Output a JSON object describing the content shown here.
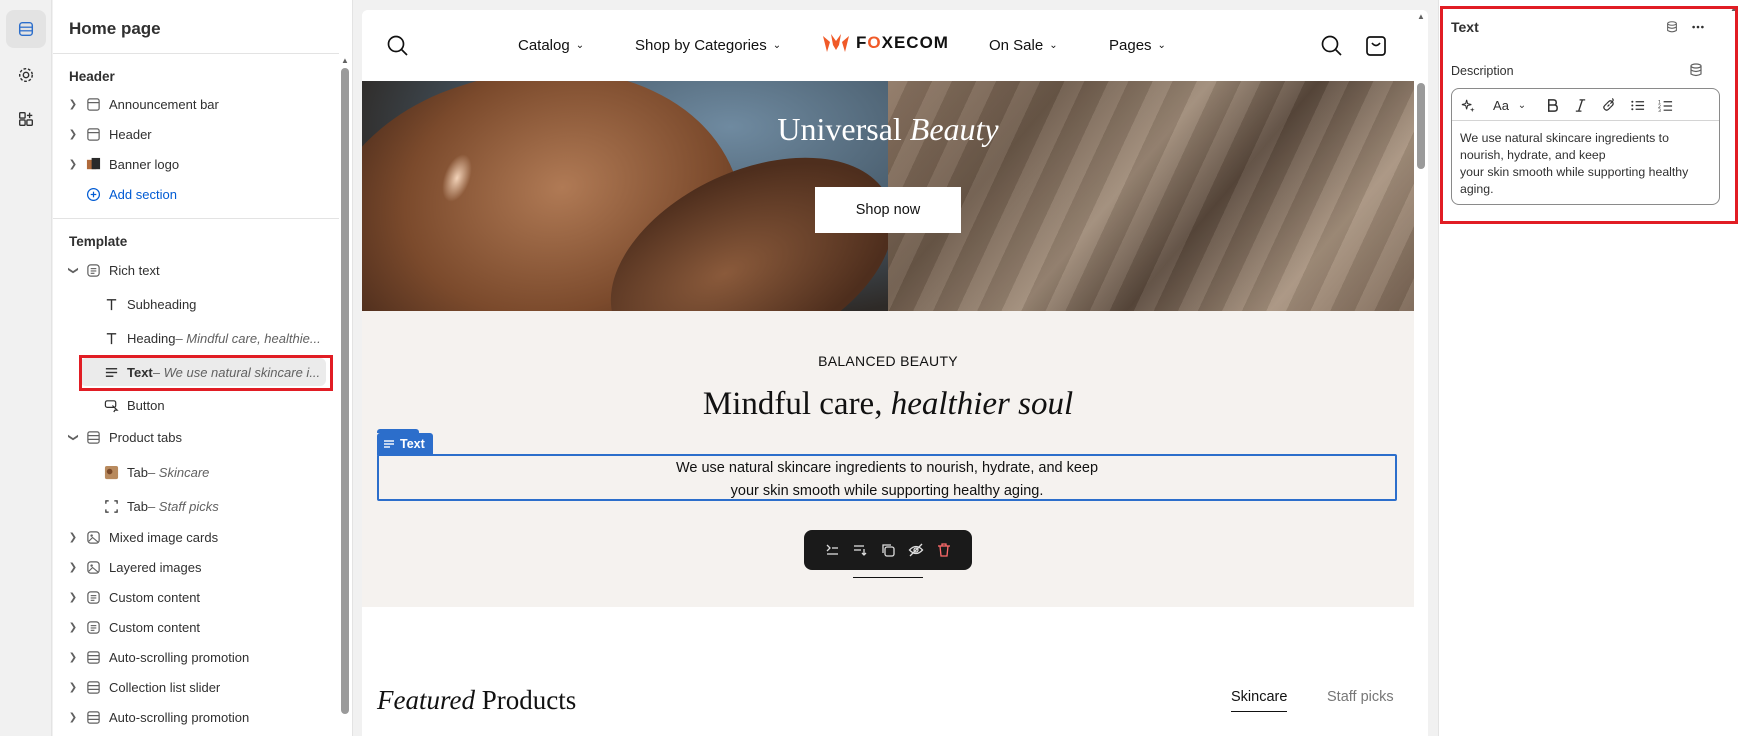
{
  "sidebar": {
    "title": "Home page",
    "header_group": "Header",
    "header_items": [
      {
        "label": "Announcement bar"
      },
      {
        "label": "Header"
      },
      {
        "label": "Banner logo"
      }
    ],
    "add_section": "Add section",
    "template_group": "Template",
    "rich_text": {
      "label": "Rich text",
      "blocks": [
        {
          "label": "Subheading",
          "detail": ""
        },
        {
          "label": "Heading",
          "detail": " – Mindful care, healthie..."
        },
        {
          "label": "Text",
          "detail": " – We use natural skincare i..."
        },
        {
          "label": "Button",
          "detail": ""
        }
      ]
    },
    "product_tabs": {
      "label": "Product tabs",
      "blocks": [
        {
          "label": "Tab",
          "detail": " – Skincare"
        },
        {
          "label": "Tab",
          "detail": " – Staff picks"
        }
      ]
    },
    "sections": [
      {
        "label": "Mixed image cards"
      },
      {
        "label": "Layered images"
      },
      {
        "label": "Custom content"
      },
      {
        "label": "Custom content"
      },
      {
        "label": "Auto-scrolling promotion"
      },
      {
        "label": "Collection list slider"
      },
      {
        "label": "Auto-scrolling promotion"
      }
    ]
  },
  "preview": {
    "nav": {
      "catalog": "Catalog",
      "shop_by_categories": "Shop by Categories",
      "logo_prefix": "F",
      "logo_o": "O",
      "logo_suffix": "XECOM",
      "on_sale": "On Sale",
      "pages": "Pages"
    },
    "hero": {
      "title_plain": "Universal ",
      "title_italic": "Beauty",
      "button": "Shop now"
    },
    "rich_text": {
      "subheading": "BALANCED BEAUTY",
      "heading_plain": "Mindful care, ",
      "heading_italic": "healthier soul",
      "text_line1": "We use natural skincare ingredients to nourish, hydrate, and keep",
      "text_line2": "your skin smooth while supporting healthy aging.",
      "tag_label": "Text"
    },
    "featured": {
      "title_italic": "Featured",
      "title_plain": " Products",
      "tab_active": "Skincare",
      "tab_inactive": "Staff picks"
    }
  },
  "inspector": {
    "title": "Text",
    "field_label": "Description",
    "editor_text": "We use natural skincare ingredients to nourish, hydrate, and keep\nyour skin smooth while supporting healthy aging.",
    "font_button": "Aa"
  },
  "colors": {
    "accent": "#2c6ecb",
    "highlight": "#e11d24",
    "brand_orange": "#f05a28"
  }
}
